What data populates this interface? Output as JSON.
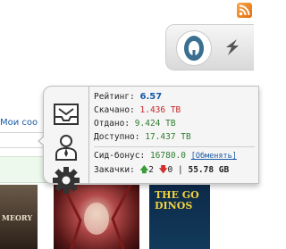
{
  "left": {
    "link_text": "Мои соо"
  },
  "popup": {
    "rating_label": "Рейтинг:",
    "rating_value": "6.57",
    "downloaded_label": "Скачано:",
    "downloaded_value": "1.436 TB",
    "uploaded_label": "Отдано:",
    "uploaded_value": "9.424 TB",
    "available_label": "Доступно:",
    "available_value": "17.437 TB",
    "bonus_label": "Сид-бонус:",
    "bonus_value": "16780.0",
    "exchange_label": "[Обменять]",
    "downloads_label": "Закачки:",
    "seeding_count": "2",
    "leeching_count": "0",
    "separator": "|",
    "total_size": "55.78 GB"
  },
  "posters": [
    {
      "title": "MEORY"
    },
    {
      "title": "THE GO DINOS"
    }
  ],
  "icons": {
    "rss": "rss-icon",
    "logo": "site-logo-icon",
    "back": "back-arrow-icon",
    "messages": "inbox-icon",
    "profile": "user-profile-icon",
    "settings": "gear-icon"
  },
  "colors": {
    "link": "#1a5aa6",
    "positive": "#2e7d32",
    "negative": "#c62828",
    "popup_bg": "#f5f5f5"
  }
}
